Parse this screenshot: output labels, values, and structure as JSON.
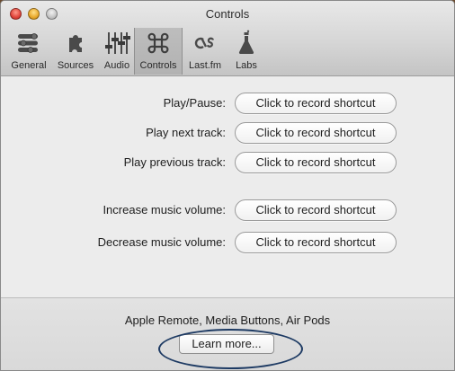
{
  "window": {
    "title": "Controls"
  },
  "toolbar": {
    "items": [
      {
        "label": "General",
        "icon": "general-icon",
        "selected": false
      },
      {
        "label": "Sources",
        "icon": "puzzle-icon",
        "selected": false
      },
      {
        "label": "Audio",
        "icon": "sliders-icon",
        "selected": false
      },
      {
        "label": "Controls",
        "icon": "command-key-icon",
        "selected": true
      },
      {
        "label": "Last.fm",
        "icon": "lastfm-icon",
        "selected": false
      },
      {
        "label": "Labs",
        "icon": "flask-icon",
        "selected": false
      }
    ]
  },
  "shortcuts": {
    "button_label": "Click to record shortcut",
    "rows": [
      {
        "label": "Play/Pause:"
      },
      {
        "label": "Play next track:"
      },
      {
        "label": "Play previous track:"
      },
      {
        "label": "Increase music volume:"
      },
      {
        "label": "Decrease music volume:"
      }
    ]
  },
  "bottom": {
    "text": "Apple Remote, Media Buttons, Air Pods",
    "learn_more_label": "Learn more...",
    "highlight_color": "#1d3a63"
  }
}
